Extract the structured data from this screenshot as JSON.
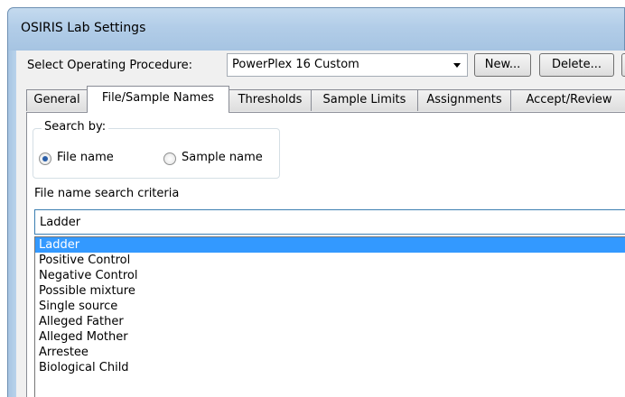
{
  "window": {
    "title": "OSIRIS Lab Settings"
  },
  "procedure": {
    "label": "Select Operating Procedure:",
    "selected": "PowerPlex 16 Custom",
    "new_button": "New...",
    "delete_button": "Delete..."
  },
  "tabs": [
    {
      "label": "General"
    },
    {
      "label": "File/Sample Names"
    },
    {
      "label": "Thresholds"
    },
    {
      "label": "Sample Limits"
    },
    {
      "label": "Assignments"
    },
    {
      "label": "Accept/Review"
    }
  ],
  "search_by": {
    "legend": "Search by:",
    "file_name": "File name",
    "sample_name": "Sample name",
    "selected": "File name"
  },
  "criteria": {
    "label": "File name search criteria",
    "value": "Ladder",
    "options": [
      "Ladder",
      "Positive Control",
      "Negative Control",
      "Possible mixture",
      "Single source",
      "Alleged Father",
      "Alleged Mother",
      "Arrestee",
      "Biological Child"
    ],
    "highlighted": "Ladder"
  }
}
